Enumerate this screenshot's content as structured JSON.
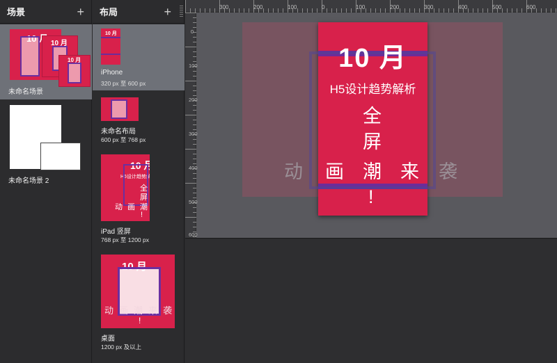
{
  "scenes_panel": {
    "title": "场景",
    "add_icon": "plus-icon",
    "scenes": [
      {
        "name": "未命名场景",
        "selected": true
      },
      {
        "name": "未命名场景 2",
        "selected": false
      }
    ]
  },
  "layouts_panel": {
    "title": "布局",
    "add_icon": "plus-icon",
    "layouts": [
      {
        "name": "iPhone",
        "range": "320 px 至 600 px",
        "selected": true
      },
      {
        "name": "未命名布局",
        "range": "600 px 至 768 px",
        "selected": false
      },
      {
        "name": "iPad 竖屏",
        "range": "768 px 至 1200 px",
        "selected": false
      },
      {
        "name": "桌面",
        "range": "1200 px 及以上",
        "selected": false
      }
    ]
  },
  "ruler": {
    "horizontal_labels": [
      "300",
      "200",
      "100",
      "0",
      "100",
      "200",
      "300",
      "400",
      "500",
      "600"
    ],
    "vertical_labels": [
      "0",
      "100",
      "200",
      "300",
      "400",
      "500",
      "600"
    ]
  },
  "design": {
    "title": "10 月",
    "subtitle": "H5设计趋势解析",
    "vertical_text": [
      "全",
      "屏",
      "潮",
      "!"
    ],
    "row_text": [
      "动",
      "画",
      "潮",
      "来",
      "袭"
    ],
    "exclaim": "!",
    "colors": {
      "poster_red": "#d8214b",
      "accent_purple": "#6c2c9a",
      "canvas_gray": "#59595e",
      "panel_dark": "#2c2c2e",
      "selection": "#6e7178"
    }
  }
}
